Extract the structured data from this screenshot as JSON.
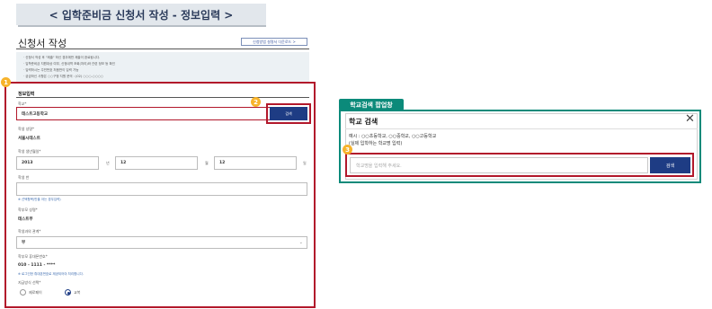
{
  "banner": {
    "title": "< 입학준비금 신청서 작성 - 정보입력 >"
  },
  "app": {
    "title": "신청서 작성",
    "guide_button": "신청방법 설명서 다운로드 >",
    "notices": [
      "· 신청서 작성 후 \"제출\" 하신 경우에만 제출이 완료됩니다.",
      "· 입학준비금 지원대상 여부, 신청내역 조회(처리)와 관련 정보 등 확인",
      "· 입력하시는 주민번호 처음만이 입력 가능",
      "· 궁금하신 사항은 ○○구청 지원 문의 : (02) ○○○-○○○○"
    ]
  },
  "badges": {
    "one": "1",
    "two": "2",
    "three": "3"
  },
  "form": {
    "section_title": "정보입력",
    "school_label": "학교*",
    "school_value": "테스트고등학교",
    "search_button": "검색",
    "student_name_label": "학생 성명*",
    "student_name_value": "서울시테스트",
    "birth_label": "학생 생년월일*",
    "birth_year": "2013",
    "birth_year_unit": "년",
    "birth_month": "12",
    "birth_month_unit": "월",
    "birth_day": "12",
    "birth_day_unit": "일",
    "class_label": "학생 반",
    "class_value": "",
    "class_note": "※ 선택항목(반을 아는 경우입력)",
    "parent_name_label": "학부모 성명*",
    "parent_name_value": "테스트부",
    "relation_label": "학생과의 관계*",
    "relation_value": "부",
    "phone_label": "학부모 휴대폰번호*",
    "phone_value": "010 - 1111 - ****",
    "phone_note": "※ 로그인한 휴대폰번호로 제공되어야 처리합니다.",
    "payment_label": "지급방식 선택*",
    "payment_options": [
      "제로페이",
      "교복"
    ],
    "payment_selected": "교복"
  },
  "popup": {
    "badge": "학교검색 팝업창",
    "title": "학교 검색",
    "close_icon": "close-icon",
    "example_line1": "예시 : ○○초등학교, ○○중학교, ○○고등학교",
    "example_line2": "(실제 입학하는 학교명 입력)",
    "input_placeholder": "학교명을 입력해 주세요.",
    "search_button": "검색"
  },
  "colors": {
    "navy": "#1e3c84",
    "highlight_red": "#b2182b",
    "popup_teal": "#0b8a7a",
    "badge_yellow": "#f7b32b"
  }
}
